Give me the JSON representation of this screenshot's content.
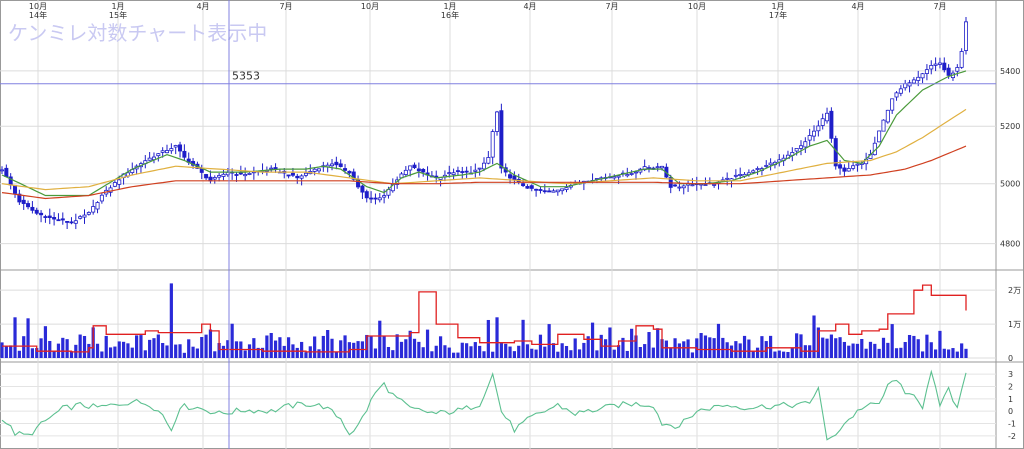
{
  "watermark": "ケンミレ対数チャート表示中",
  "chart_data": [
    {
      "type": "line",
      "panel": "price",
      "scale": "log",
      "ylim": [
        4740,
        5660
      ],
      "y_ticks": [
        {
          "value": 4800,
          "label": "4800"
        },
        {
          "value": 5000,
          "label": "5000"
        },
        {
          "value": 5200,
          "label": "5200"
        },
        {
          "value": 5400,
          "label": "5400"
        }
      ],
      "x_ticks": [
        {
          "label": "10月",
          "sub": "14年"
        },
        {
          "label": "1月",
          "sub": "15年"
        },
        {
          "label": "4月",
          "sub": ""
        },
        {
          "label": "7月",
          "sub": ""
        },
        {
          "label": "10月",
          "sub": ""
        },
        {
          "label": "1月",
          "sub": "16年"
        },
        {
          "label": "4月",
          "sub": ""
        },
        {
          "label": "7月",
          "sub": ""
        },
        {
          "label": "10月",
          "sub": ""
        },
        {
          "label": "1月",
          "sub": "17年"
        },
        {
          "label": "4月",
          "sub": ""
        },
        {
          "label": "7月",
          "sub": ""
        }
      ],
      "crosshair": {
        "value": 5353,
        "label": "5353"
      },
      "price_path": [
        [
          0,
          5050
        ],
        [
          4,
          4940
        ],
        [
          8,
          4900
        ],
        [
          12,
          4880
        ],
        [
          16,
          4870
        ],
        [
          20,
          4900
        ],
        [
          23,
          4960
        ],
        [
          28,
          5030
        ],
        [
          33,
          5080
        ],
        [
          37,
          5110
        ],
        [
          40,
          5130
        ],
        [
          42,
          5090
        ],
        [
          45,
          5050
        ],
        [
          48,
          5010
        ],
        [
          52,
          5040
        ],
        [
          55,
          5030
        ],
        [
          58,
          5040
        ],
        [
          62,
          5050
        ],
        [
          64,
          5040
        ],
        [
          68,
          5020
        ],
        [
          72,
          5050
        ],
        [
          76,
          5070
        ],
        [
          80,
          5040
        ],
        [
          82,
          4990
        ],
        [
          84,
          4950
        ],
        [
          86,
          4950
        ],
        [
          88,
          4960
        ],
        [
          90,
          5000
        ],
        [
          94,
          5060
        ],
        [
          98,
          5030
        ],
        [
          100,
          5020
        ],
        [
          102,
          5030
        ],
        [
          104,
          5040
        ],
        [
          106,
          5040
        ],
        [
          108,
          5040
        ],
        [
          110,
          5050
        ],
        [
          112,
          5090
        ],
        [
          113,
          5180
        ],
        [
          114,
          5250
        ],
        [
          115,
          5050
        ],
        [
          118,
          5010
        ],
        [
          122,
          4980
        ],
        [
          126,
          4970
        ],
        [
          130,
          4990
        ],
        [
          134,
          5010
        ],
        [
          138,
          5020
        ],
        [
          142,
          5030
        ],
        [
          146,
          5040
        ],
        [
          148,
          5060
        ],
        [
          150,
          5050
        ],
        [
          152,
          5060
        ],
        [
          154,
          4990
        ],
        [
          156,
          4990
        ],
        [
          158,
          5000
        ],
        [
          160,
          5000
        ],
        [
          164,
          5000
        ],
        [
          168,
          5020
        ],
        [
          172,
          5040
        ],
        [
          176,
          5060
        ],
        [
          180,
          5090
        ],
        [
          184,
          5130
        ],
        [
          188,
          5200
        ],
        [
          190,
          5250
        ],
        [
          192,
          5060
        ],
        [
          194,
          5040
        ],
        [
          196,
          5060
        ],
        [
          198,
          5070
        ],
        [
          200,
          5100
        ],
        [
          202,
          5180
        ],
        [
          205,
          5300
        ],
        [
          208,
          5350
        ],
        [
          211,
          5380
        ],
        [
          214,
          5420
        ],
        [
          216,
          5430
        ],
        [
          218,
          5380
        ],
        [
          220,
          5410
        ],
        [
          221,
          5470
        ],
        [
          222,
          5580
        ]
      ],
      "series": [
        {
          "color": "#4a9a3a",
          "values": [
            [
              0,
              5030
            ],
            [
              10,
              4960
            ],
            [
              20,
              4960
            ],
            [
              30,
              5050
            ],
            [
              38,
              5100
            ],
            [
              42,
              5080
            ],
            [
              48,
              5040
            ],
            [
              56,
              5040
            ],
            [
              64,
              5050
            ],
            [
              70,
              5050
            ],
            [
              74,
              5060
            ],
            [
              78,
              5050
            ],
            [
              84,
              4990
            ],
            [
              88,
              4970
            ],
            [
              92,
              5020
            ],
            [
              96,
              5040
            ],
            [
              100,
              5020
            ],
            [
              106,
              5030
            ],
            [
              110,
              5040
            ],
            [
              114,
              5070
            ],
            [
              118,
              5030
            ],
            [
              124,
              4990
            ],
            [
              130,
              4990
            ],
            [
              136,
              5010
            ],
            [
              142,
              5030
            ],
            [
              148,
              5050
            ],
            [
              152,
              5050
            ],
            [
              156,
              5000
            ],
            [
              162,
              5000
            ],
            [
              168,
              5010
            ],
            [
              174,
              5040
            ],
            [
              180,
              5080
            ],
            [
              186,
              5130
            ],
            [
              190,
              5150
            ],
            [
              194,
              5080
            ],
            [
              198,
              5070
            ],
            [
              202,
              5130
            ],
            [
              206,
              5240
            ],
            [
              212,
              5330
            ],
            [
              218,
              5380
            ],
            [
              222,
              5400
            ]
          ]
        },
        {
          "color": "#e0b040",
          "values": [
            [
              0,
              5000
            ],
            [
              10,
              4980
            ],
            [
              20,
              4990
            ],
            [
              30,
              5030
            ],
            [
              40,
              5060
            ],
            [
              50,
              5050
            ],
            [
              60,
              5040
            ],
            [
              70,
              5040
            ],
            [
              80,
              5020
            ],
            [
              90,
              5000
            ],
            [
              100,
              5010
            ],
            [
              110,
              5020
            ],
            [
              120,
              5010
            ],
            [
              130,
              5000
            ],
            [
              140,
              5010
            ],
            [
              150,
              5020
            ],
            [
              160,
              5010
            ],
            [
              170,
              5010
            ],
            [
              180,
              5040
            ],
            [
              190,
              5070
            ],
            [
              200,
              5080
            ],
            [
              206,
              5110
            ],
            [
              212,
              5160
            ],
            [
              218,
              5220
            ],
            [
              222,
              5260
            ]
          ]
        },
        {
          "color": "#d04020",
          "values": [
            [
              0,
              4970
            ],
            [
              10,
              4950
            ],
            [
              20,
              4960
            ],
            [
              30,
              4990
            ],
            [
              40,
              5010
            ],
            [
              50,
              5010
            ],
            [
              60,
              5010
            ],
            [
              70,
              5010
            ],
            [
              80,
              5010
            ],
            [
              90,
              5000
            ],
            [
              100,
              5000
            ],
            [
              110,
              5005
            ],
            [
              120,
              5005
            ],
            [
              130,
              5005
            ],
            [
              140,
              5005
            ],
            [
              150,
              5005
            ],
            [
              160,
              5000
            ],
            [
              170,
              5000
            ],
            [
              180,
              5010
            ],
            [
              190,
              5020
            ],
            [
              200,
              5030
            ],
            [
              208,
              5050
            ],
            [
              214,
              5080
            ],
            [
              218,
              5105
            ],
            [
              222,
              5130
            ]
          ]
        }
      ]
    },
    {
      "type": "bar",
      "panel": "volume",
      "ylim": [
        0,
        23000
      ],
      "y_ticks": [
        {
          "value": 0,
          "label": "0"
        },
        {
          "value": 10000,
          "label": "1万"
        },
        {
          "value": 20000,
          "label": "2万"
        }
      ],
      "red_line": [
        [
          0,
          3500
        ],
        [
          8,
          2000
        ],
        [
          16,
          1800
        ],
        [
          20,
          3000
        ],
        [
          21,
          9500
        ],
        [
          23,
          9500
        ],
        [
          24,
          7000
        ],
        [
          32,
          7000
        ],
        [
          33,
          8000
        ],
        [
          35,
          8000
        ],
        [
          36,
          7500
        ],
        [
          45,
          7500
        ],
        [
          46,
          10000
        ],
        [
          48,
          8000
        ],
        [
          50,
          2500
        ],
        [
          60,
          2000
        ],
        [
          70,
          1800
        ],
        [
          80,
          2500
        ],
        [
          84,
          6500
        ],
        [
          94,
          7500
        ],
        [
          96,
          19500
        ],
        [
          99,
          19500
        ],
        [
          100,
          10000
        ],
        [
          104,
          10000
        ],
        [
          105,
          6000
        ],
        [
          108,
          6000
        ],
        [
          110,
          4500
        ],
        [
          118,
          5000
        ],
        [
          122,
          4000
        ],
        [
          128,
          7000
        ],
        [
          134,
          5500
        ],
        [
          138,
          3500
        ],
        [
          142,
          5000
        ],
        [
          146,
          9500
        ],
        [
          150,
          8500
        ],
        [
          152,
          3000
        ],
        [
          160,
          2500
        ],
        [
          168,
          2000
        ],
        [
          176,
          3000
        ],
        [
          184,
          2000
        ],
        [
          188,
          8000
        ],
        [
          192,
          10000
        ],
        [
          195,
          7000
        ],
        [
          198,
          8000
        ],
        [
          202,
          8500
        ],
        [
          204,
          13000
        ],
        [
          210,
          20000
        ],
        [
          212,
          21500
        ],
        [
          214,
          18500
        ],
        [
          218,
          18500
        ],
        [
          222,
          14000
        ]
      ]
    },
    {
      "type": "line",
      "panel": "oscillator",
      "ylim": [
        -2.5,
        3.5
      ],
      "y_ticks": [
        {
          "value": 3,
          "label": "3"
        },
        {
          "value": 2,
          "label": "2"
        },
        {
          "value": 1,
          "label": "1"
        },
        {
          "value": 0,
          "label": "0"
        },
        {
          "value": -1,
          "label": "-1"
        },
        {
          "value": -2,
          "label": "-2"
        }
      ],
      "values": [
        [
          0,
          -0.5
        ],
        [
          3,
          -1.8
        ],
        [
          6,
          -2.0
        ],
        [
          10,
          -0.8
        ],
        [
          14,
          0.2
        ],
        [
          18,
          0.5
        ],
        [
          22,
          0.3
        ],
        [
          26,
          0.5
        ],
        [
          30,
          0.8
        ],
        [
          34,
          0.6
        ],
        [
          37,
          -0.3
        ],
        [
          39,
          -1.5
        ],
        [
          41,
          0.4
        ],
        [
          45,
          0.3
        ],
        [
          50,
          -0.2
        ],
        [
          56,
          0.1
        ],
        [
          62,
          0.0
        ],
        [
          66,
          0.4
        ],
        [
          70,
          0.6
        ],
        [
          74,
          0.4
        ],
        [
          78,
          -0.6
        ],
        [
          80,
          -1.8
        ],
        [
          82,
          -1.2
        ],
        [
          86,
          1.5
        ],
        [
          88,
          2.2
        ],
        [
          90,
          1.3
        ],
        [
          94,
          0.2
        ],
        [
          100,
          -0.2
        ],
        [
          106,
          0.1
        ],
        [
          110,
          0.6
        ],
        [
          113,
          3.0
        ],
        [
          115,
          0.0
        ],
        [
          118,
          -1.5
        ],
        [
          122,
          -0.5
        ],
        [
          128,
          0.5
        ],
        [
          132,
          -0.2
        ],
        [
          138,
          0.2
        ],
        [
          142,
          0.5
        ],
        [
          146,
          0.6
        ],
        [
          150,
          0.5
        ],
        [
          152,
          -1.0
        ],
        [
          156,
          -1.2
        ],
        [
          160,
          0.0
        ],
        [
          166,
          0.5
        ],
        [
          172,
          0.3
        ],
        [
          176,
          0.4
        ],
        [
          182,
          0.5
        ],
        [
          186,
          0.6
        ],
        [
          188,
          2.0
        ],
        [
          190,
          -2.5
        ],
        [
          192,
          -1.8
        ],
        [
          194,
          -1.0
        ],
        [
          198,
          0.3
        ],
        [
          202,
          0.6
        ],
        [
          204,
          2.0
        ],
        [
          206,
          2.7
        ],
        [
          208,
          1.2
        ],
        [
          210,
          1.5
        ],
        [
          212,
          0.4
        ],
        [
          214,
          3.0
        ],
        [
          216,
          0.5
        ],
        [
          218,
          1.7
        ],
        [
          220,
          0.3
        ],
        [
          222,
          3.3
        ]
      ]
    }
  ]
}
